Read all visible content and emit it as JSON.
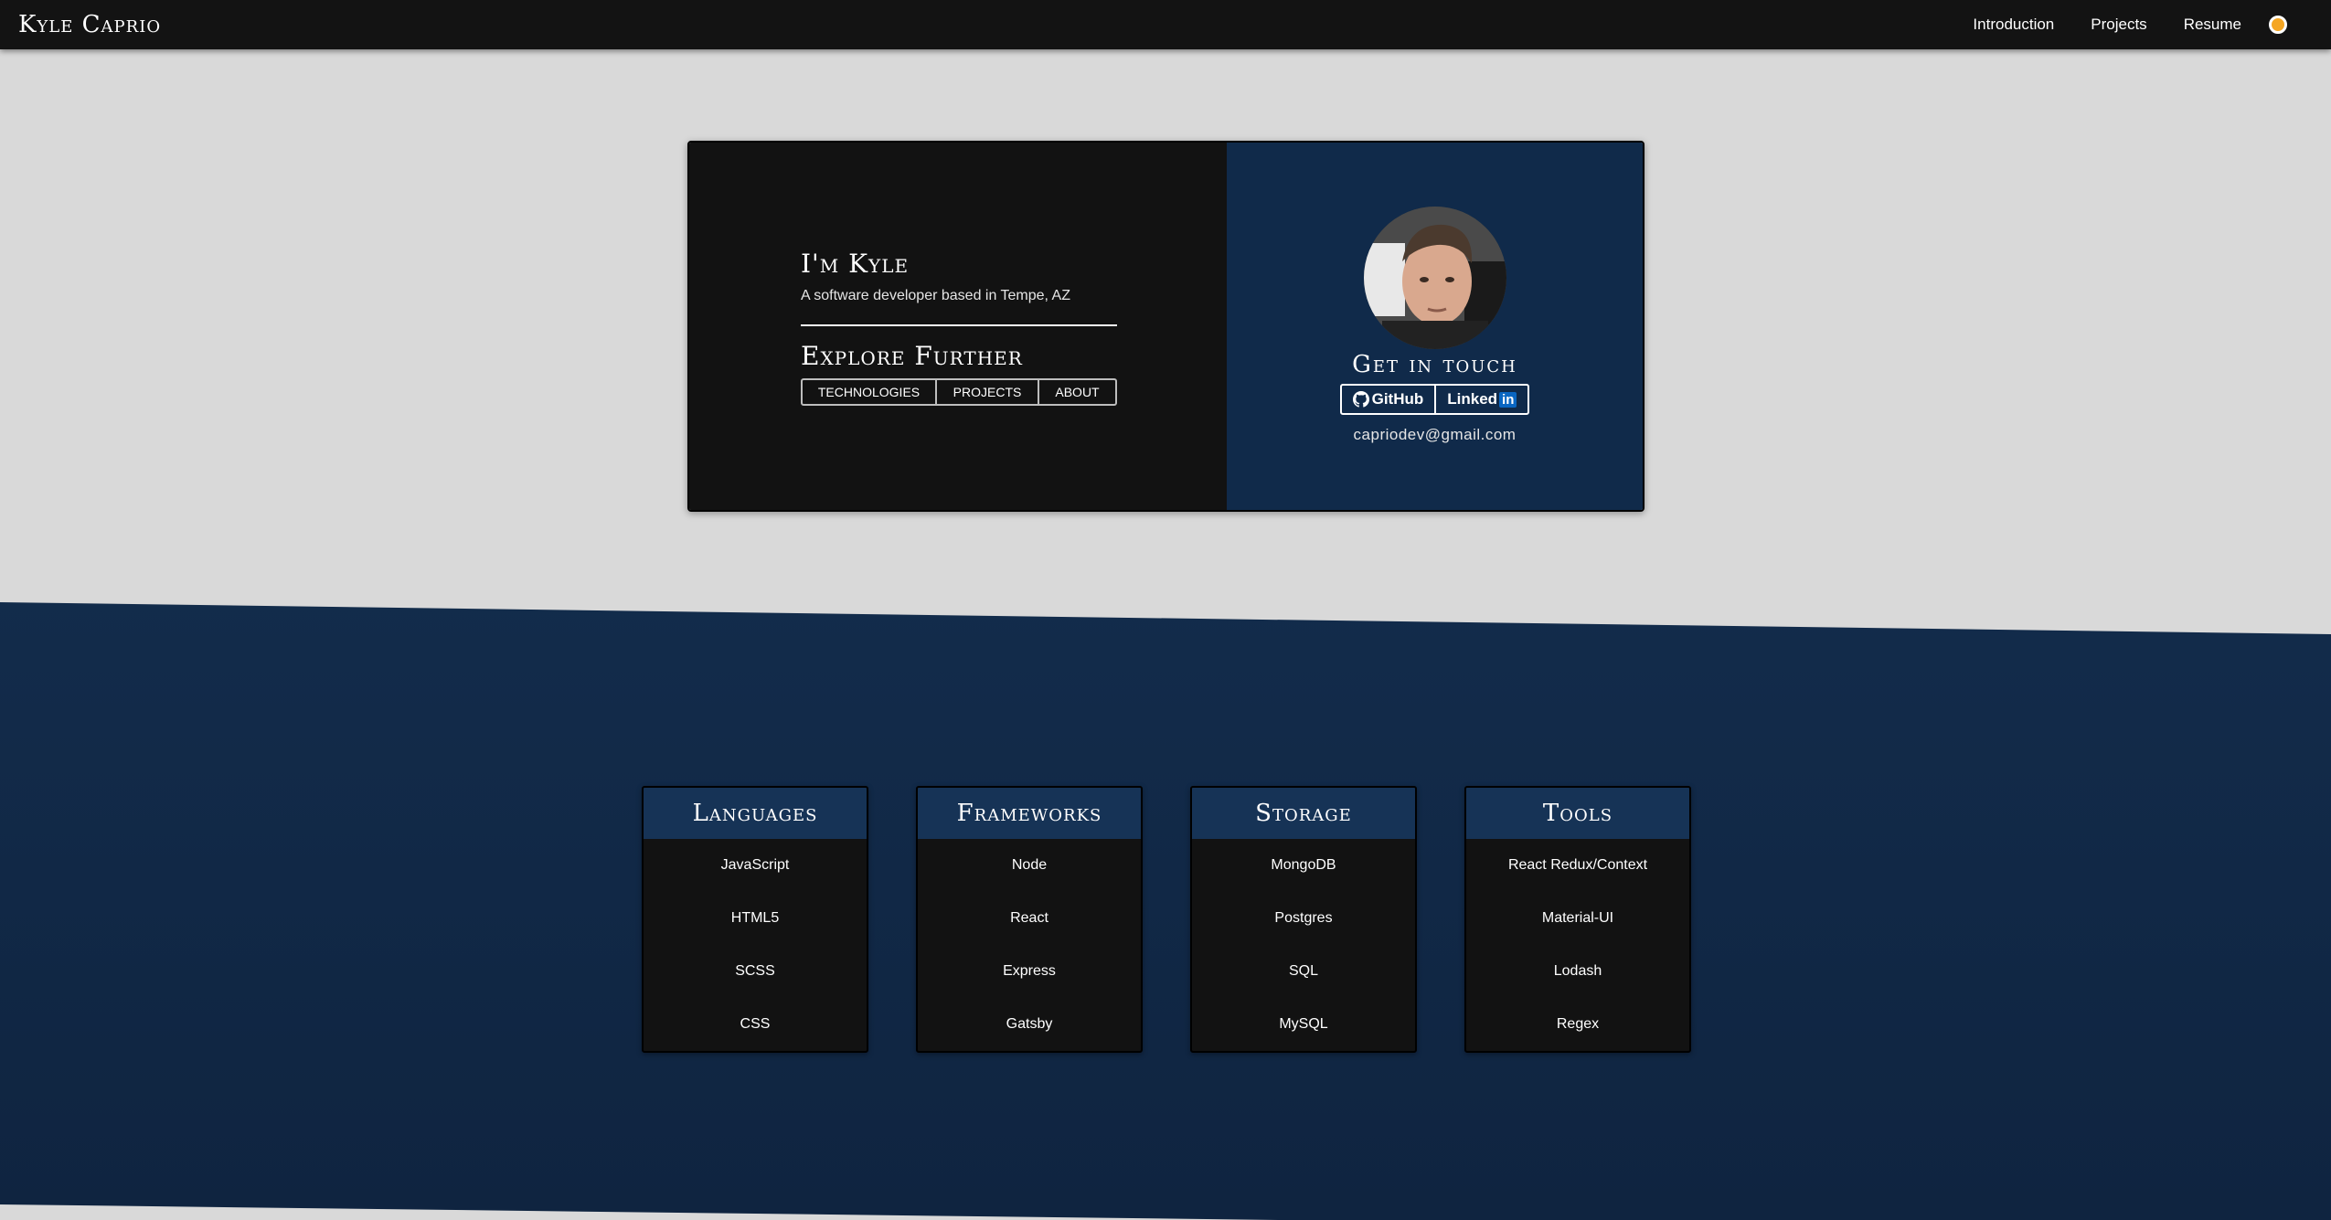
{
  "nav": {
    "brand": "Kyle Caprio",
    "links": [
      "Introduction",
      "Projects",
      "Resume"
    ]
  },
  "hero": {
    "title": "I'm Kyle",
    "subtitle": "A software developer based in Tempe, AZ",
    "explore_title": "Explore Further",
    "buttons": [
      "TECHNOLOGIES",
      "PROJECTS",
      "ABOUT"
    ]
  },
  "contact": {
    "title": "Get in touch",
    "github_label": "GitHub",
    "linkedin_label": "Linked",
    "linkedin_box": "in",
    "email": "capriodev@gmail.com"
  },
  "tech": [
    {
      "title": "Languages",
      "items": [
        "JavaScript",
        "HTML5",
        "SCSS",
        "CSS"
      ]
    },
    {
      "title": "Frameworks",
      "items": [
        "Node",
        "React",
        "Express",
        "Gatsby"
      ]
    },
    {
      "title": "Storage",
      "items": [
        "MongoDB",
        "Postgres",
        "SQL",
        "MySQL"
      ]
    },
    {
      "title": "Tools",
      "items": [
        "React Redux/Context",
        "Material-UI",
        "Lodash",
        "Regex"
      ]
    }
  ],
  "colors": {
    "navbar": "#131313",
    "page_bg": "#d9d9d9",
    "navy": "#102a4a",
    "accent_toggle": "#f5a623"
  }
}
